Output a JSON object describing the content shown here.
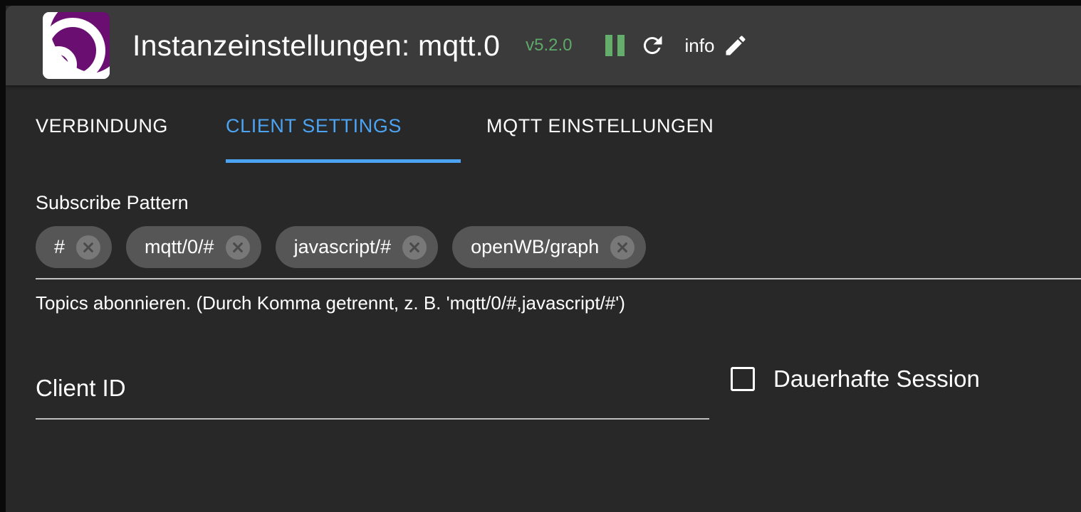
{
  "window": {
    "background": "#282828",
    "header_background": "#3b3b3b"
  },
  "header": {
    "logo_name": "iobroker-logo",
    "title": "Instanzeinstellungen: mqtt.0",
    "version": "v5.2.0",
    "version_color": "#5fa86a",
    "actions": [
      {
        "name": "pause-button",
        "icon": "pause-icon",
        "color": "#64ad6a"
      },
      {
        "name": "reload-button",
        "icon": "refresh-icon",
        "color": "#ffffff"
      }
    ],
    "info_label": "info",
    "edit_icon": "pencil-icon"
  },
  "tabs": {
    "active_index": 1,
    "accent_color": "#4ba3f2",
    "items": [
      {
        "label": "VERBINDUNG"
      },
      {
        "label": "CLIENT SETTINGS"
      },
      {
        "label": "MQTT EINSTELLUNGEN"
      }
    ]
  },
  "form": {
    "subscribe": {
      "label": "Subscribe Pattern",
      "chips": [
        {
          "label": "#"
        },
        {
          "label": "mqtt/0/#"
        },
        {
          "label": "javascript/#"
        },
        {
          "label": "openWB/graph"
        }
      ],
      "helper": "Topics abonnieren. (Durch Komma getrennt, z. B. 'mqtt/0/#,javascript/#')"
    },
    "client_id": {
      "label": "Client ID",
      "value": "",
      "placeholder": "Client ID"
    },
    "persistent_session": {
      "label": "Dauerhafte Session",
      "checked": false
    }
  }
}
